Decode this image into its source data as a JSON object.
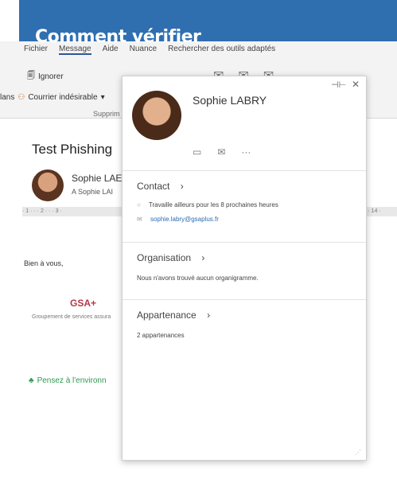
{
  "banner": {
    "headline": "Comment vérifier"
  },
  "ribbon": {
    "tabs": [
      "Fichier",
      "Message",
      "Aide",
      "Nuance",
      "Rechercher des outils adaptés"
    ],
    "ignore": "Ignorer",
    "junk": "Courrier indésirable",
    "left_fragment": "lans",
    "delete_group": "Supprim"
  },
  "mail": {
    "subject": "Test Phishing",
    "sender_name": "Sophie LAE",
    "sender_to": "A  Sophie LAI",
    "ruler_left": "· 1 · · · 2 · · · 3 ·",
    "ruler_right": "· · 14 ·",
    "greeting": "Bien à vous,",
    "signature_logo": "GSA+",
    "signature_sub": "Groupement de services assura",
    "env_text": "Pensez à l'environn"
  },
  "card": {
    "name": "Sophie LABRY",
    "contact_title": "Contact",
    "status": "Travaille ailleurs pour les 8 prochaines heures",
    "email": "sophie.labry@gsaplus.fr",
    "org_title": "Organisation",
    "org_text": "Nous n'avons trouvé aucun organigramme.",
    "member_title": "Appartenance",
    "member_text": "2 appartenances",
    "more": "···"
  }
}
